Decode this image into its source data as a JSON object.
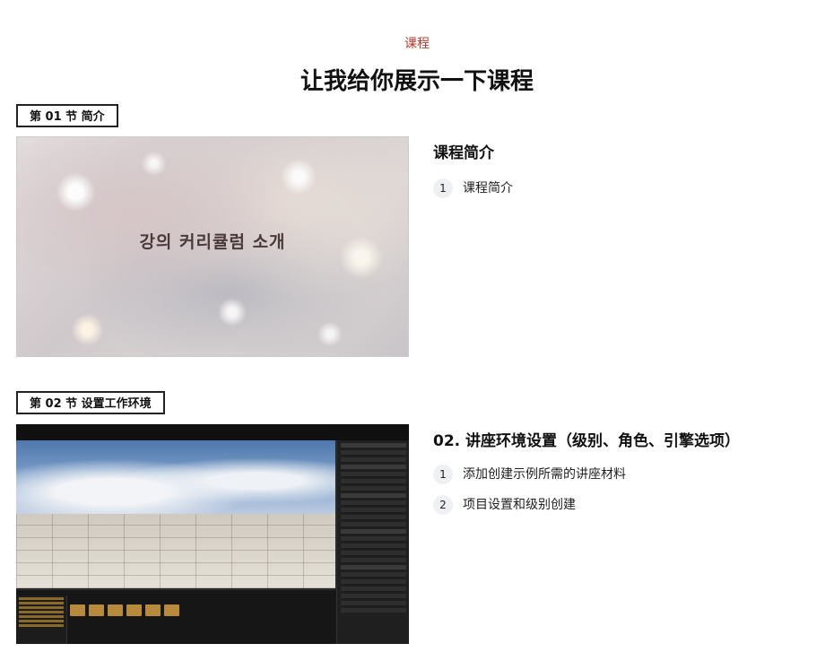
{
  "header": {
    "eyebrow": "课程",
    "title": "让我给你展示一下课程"
  },
  "sections": [
    {
      "tag": "第 01 节 简介",
      "thumbnail_text": "강의 커리큘럼 소개",
      "lesson_title": "课程简介",
      "items": [
        {
          "num": "1",
          "label": "课程简介"
        }
      ]
    },
    {
      "tag": "第 02 节 设置工作环境",
      "lesson_title": "02. 讲座环境设置（级别、角色、引擎选项）",
      "items": [
        {
          "num": "1",
          "label": "添加创建示例所需的讲座材料"
        },
        {
          "num": "2",
          "label": "项目设置和级别创建"
        }
      ]
    }
  ],
  "colors": {
    "eyebrow": "#c0392b",
    "tag_border": "#222222",
    "number_badge_bg": "#eef0f4"
  }
}
